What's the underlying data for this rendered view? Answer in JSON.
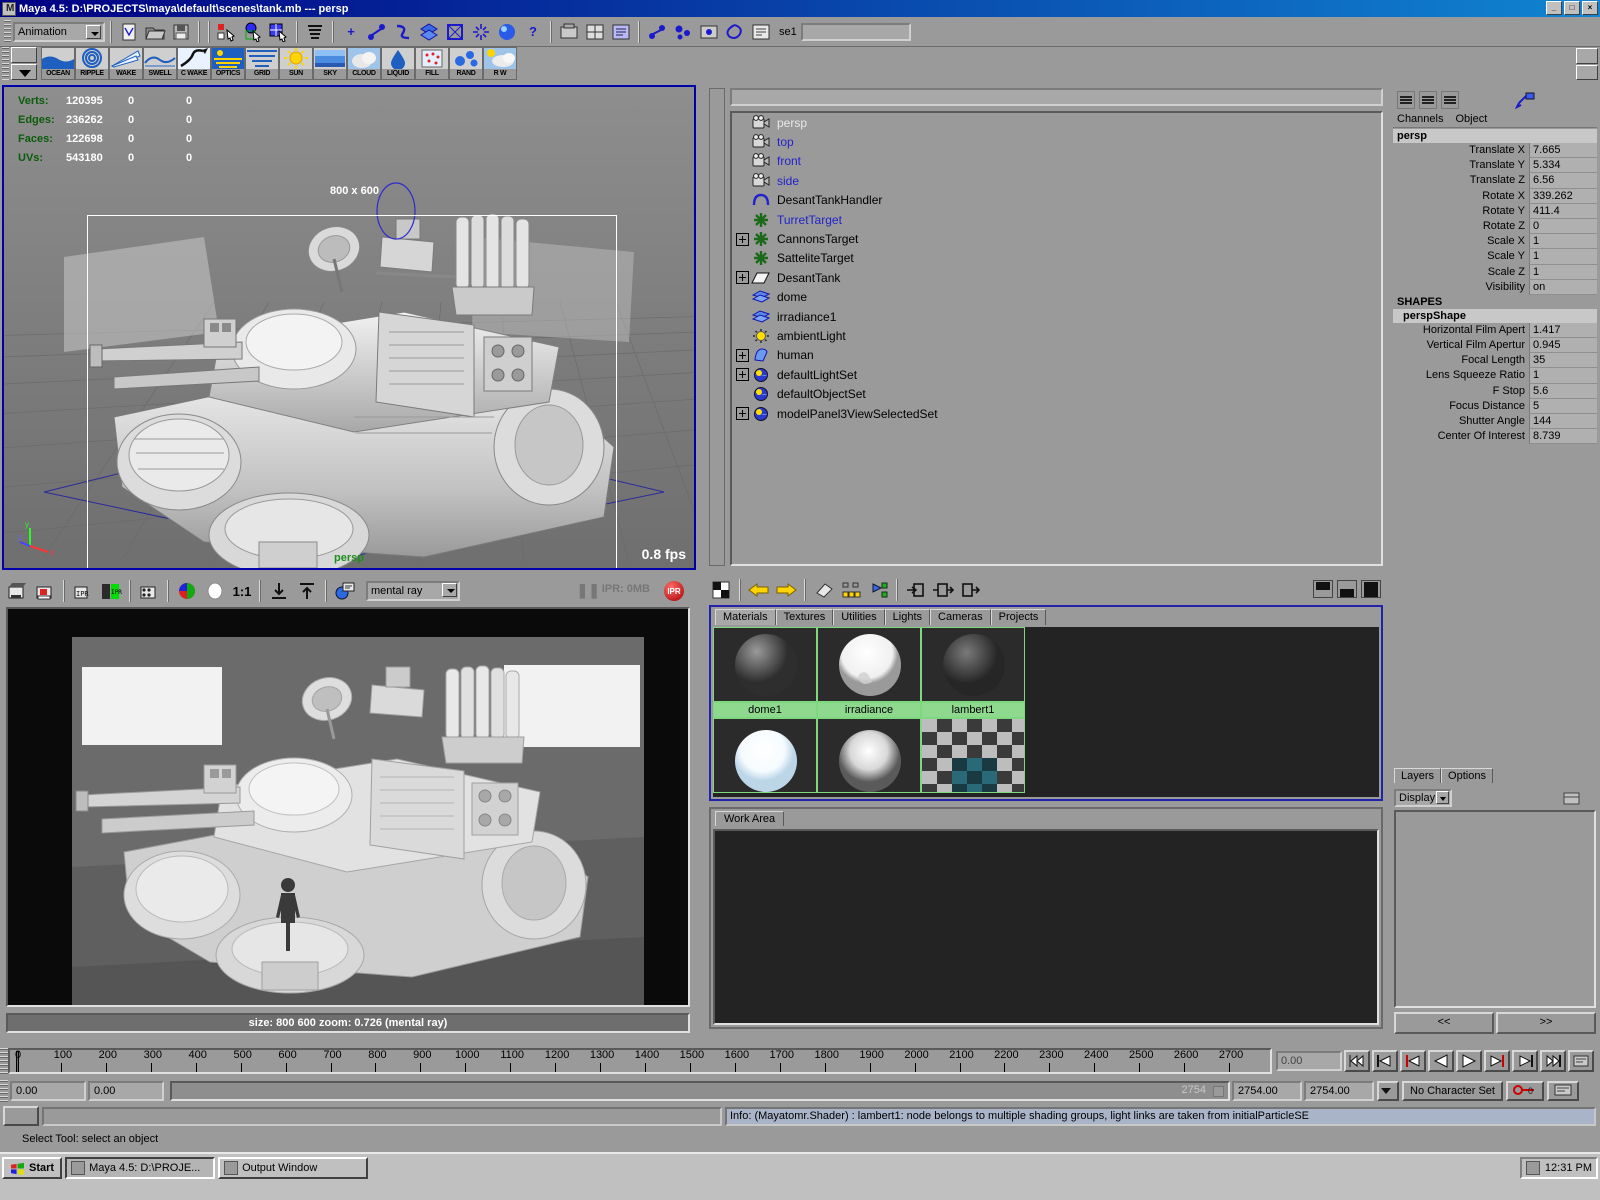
{
  "titlebar": {
    "title": "Maya 4.5: D:\\PROJECTS\\maya\\default\\scenes\\tank.mb    ---    persp",
    "icon": "maya-icon",
    "minimize": "_",
    "maximize": "□",
    "close": "×"
  },
  "statusline": {
    "mode": "Animation",
    "selection_label": "se1",
    "selection_value": ""
  },
  "shelf": {
    "items": [
      {
        "label": "OCEAN",
        "icon": "ocean-icon"
      },
      {
        "label": "RIPPLE",
        "icon": "ripple-icon"
      },
      {
        "label": "WAKE",
        "icon": "wake-icon"
      },
      {
        "label": "SWELL",
        "icon": "swell-icon"
      },
      {
        "label": "C WAKE",
        "icon": "cwake-icon"
      },
      {
        "label": "OPTICS",
        "icon": "optics-icon"
      },
      {
        "label": "GRID",
        "icon": "grid-icon"
      },
      {
        "label": "SUN",
        "icon": "sun-icon"
      },
      {
        "label": "SKY",
        "icon": "sky-icon"
      },
      {
        "label": "CLOUD",
        "icon": "cloud-icon"
      },
      {
        "label": "LIQUID",
        "icon": "liquid-icon"
      },
      {
        "label": "FILL",
        "icon": "fill-icon"
      },
      {
        "label": "RAND",
        "icon": "rand-icon"
      },
      {
        "label": "R W",
        "icon": "rw-icon"
      }
    ]
  },
  "viewport": {
    "stats": [
      {
        "label": "Verts:",
        "v1": "120395",
        "v2": "0",
        "v3": "0"
      },
      {
        "label": "Edges:",
        "v1": "236262",
        "v2": "0",
        "v3": "0"
      },
      {
        "label": "Faces:",
        "v1": "122698",
        "v2": "0",
        "v3": "0"
      },
      {
        "label": "UVs:",
        "v1": "543180",
        "v2": "0",
        "v3": "0"
      }
    ],
    "resolution": "800 x 600",
    "fps": "0.8 fps",
    "camera": "persp",
    "axis_x": "x",
    "axis_y": "y",
    "axis_z": "z"
  },
  "outliner": {
    "search_value": "",
    "items": [
      {
        "label": "persp",
        "icon": "camera-icon",
        "expandable": false,
        "selected": false,
        "white": true
      },
      {
        "label": "top",
        "icon": "camera-icon",
        "expandable": false,
        "selected": true
      },
      {
        "label": "front",
        "icon": "camera-icon",
        "expandable": false,
        "selected": true
      },
      {
        "label": "side",
        "icon": "camera-icon",
        "expandable": false,
        "selected": true
      },
      {
        "label": "DesantTankHandler",
        "icon": "curve-icon",
        "expandable": false,
        "selected": false
      },
      {
        "label": "TurretTarget",
        "icon": "locator-icon",
        "expandable": false,
        "selected": true
      },
      {
        "label": "CannonsTarget",
        "icon": "locator-icon",
        "expandable": true,
        "selected": false
      },
      {
        "label": "SatteliteTarget",
        "icon": "locator-icon",
        "expandable": false,
        "selected": false
      },
      {
        "label": "DesantTank",
        "icon": "mesh-icon",
        "expandable": true,
        "selected": false
      },
      {
        "label": "dome",
        "icon": "nurbs-icon",
        "expandable": false,
        "selected": false
      },
      {
        "label": "irradiance1",
        "icon": "nurbs-icon",
        "expandable": false,
        "selected": false
      },
      {
        "label": "ambientLight",
        "icon": "light-icon",
        "expandable": false,
        "selected": false
      },
      {
        "label": "human",
        "icon": "surface-icon",
        "expandable": true,
        "selected": false
      },
      {
        "label": "defaultLightSet",
        "icon": "set-icon",
        "expandable": true,
        "selected": false
      },
      {
        "label": "defaultObjectSet",
        "icon": "set-icon",
        "expandable": false,
        "selected": false
      },
      {
        "label": "modelPanel3ViewSelectedSet",
        "icon": "set-icon",
        "expandable": true,
        "selected": false
      }
    ]
  },
  "channelbox": {
    "menus": [
      "Channels",
      "Object"
    ],
    "node_name": "persp",
    "transform_channels": [
      {
        "name": "Translate X",
        "value": "7.665"
      },
      {
        "name": "Translate Y",
        "value": "5.334"
      },
      {
        "name": "Translate Z",
        "value": "6.56"
      },
      {
        "name": "Rotate X",
        "value": "339.262"
      },
      {
        "name": "Rotate Y",
        "value": "411.4"
      },
      {
        "name": "Rotate Z",
        "value": "0"
      },
      {
        "name": "Scale X",
        "value": "1"
      },
      {
        "name": "Scale Y",
        "value": "1"
      },
      {
        "name": "Scale Z",
        "value": "1"
      },
      {
        "name": "Visibility",
        "value": "on"
      }
    ],
    "shapes_header": "SHAPES",
    "shape_name": "perspShape",
    "shape_channels": [
      {
        "name": "Horizontal Film Apert",
        "value": "1.417"
      },
      {
        "name": "Vertical Film Apertur",
        "value": "0.945"
      },
      {
        "name": "Focal Length",
        "value": "35"
      },
      {
        "name": "Lens Squeeze Ratio",
        "value": "1"
      },
      {
        "name": "F Stop",
        "value": "5.6"
      },
      {
        "name": "Focus Distance",
        "value": "5"
      },
      {
        "name": "Shutter Angle",
        "value": "144"
      },
      {
        "name": "Center Of Interest",
        "value": "8.739"
      }
    ]
  },
  "layers": {
    "tabs": [
      "Layers",
      "Options"
    ],
    "display_label": "Display",
    "nav_prev": "<<",
    "nav_next": ">>"
  },
  "renderview": {
    "renderer": "mental ray",
    "ipr_label": "IPR: 0MB",
    "ipr_badge": "IPR",
    "status": "size:  800  600 zoom: 0.726  (mental ray)"
  },
  "hypershade": {
    "tabs": [
      "Materials",
      "Textures",
      "Utilities",
      "Lights",
      "Cameras",
      "Projects"
    ],
    "active_tab": "Materials",
    "swatches_row1": [
      {
        "name": "dome1",
        "type": "sphere-gray"
      },
      {
        "name": "irradiance",
        "type": "sphere-white"
      },
      {
        "name": "lambert1",
        "type": "sphere-darkgray"
      }
    ],
    "swatches_row2": [
      {
        "name": "",
        "type": "sphere-bright"
      },
      {
        "name": "",
        "type": "sphere-soft"
      },
      {
        "name": "",
        "type": "checker-teal"
      }
    ],
    "work_area_tab": "Work Area"
  },
  "timeslider": {
    "ticks": [
      "0",
      "100",
      "200",
      "300",
      "400",
      "500",
      "600",
      "700",
      "800",
      "900",
      "1000",
      "1100",
      "1200",
      "1300",
      "1400",
      "1500",
      "1600",
      "1700",
      "1800",
      "1900",
      "2000",
      "2100",
      "2200",
      "2300",
      "2400",
      "2500",
      "2600",
      "2700"
    ],
    "current_time": "0.00",
    "playback_buttons": [
      "go-to-start",
      "step-back-key",
      "step-back-frame",
      "play-backwards",
      "play-forwards",
      "step-forward-frame",
      "step-forward-key",
      "go-to-end"
    ]
  },
  "rangeslider": {
    "start_field": "0.00",
    "end_field": "0.00",
    "anim_end_readout": "2754",
    "playback_end": "2754.00",
    "range_end": "2754.00",
    "character_set": "No Character Set",
    "auto_key": "auto-key-icon",
    "anim_prefs": "anim-prefs-icon"
  },
  "commandline": {
    "info": "Info: (Mayatomr.Shader) : lambert1: node belongs to multiple shading groups, light links are taken from initialParticleSE"
  },
  "helpline": {
    "text": "Select Tool: select an object"
  },
  "taskbar": {
    "start": "Start",
    "tasks": [
      {
        "label": "Maya 4.5: D:\\PROJE...",
        "active": true,
        "icon": "maya-icon"
      },
      {
        "label": "Output Window",
        "active": false,
        "icon": "window-icon"
      }
    ],
    "clock": "12:31 PM"
  },
  "colors": {
    "accent_blue": "#000082",
    "panel_gray": "#9a9a9a",
    "hud_green": "#0a5c0a",
    "swatch_green": "#8fd98f",
    "selected_blue": "#2222cc"
  }
}
